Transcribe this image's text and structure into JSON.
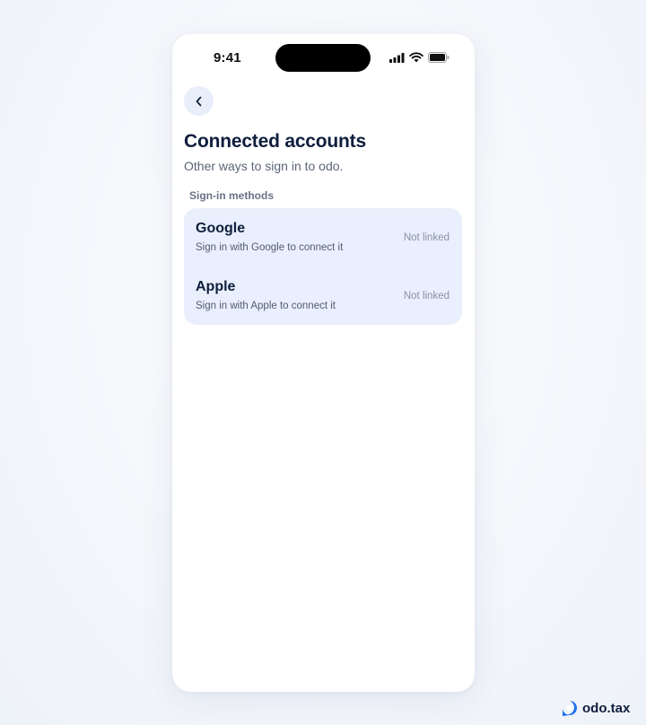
{
  "status_bar": {
    "time": "9:41",
    "icons": [
      "signal-icon",
      "wifi-icon",
      "battery-icon"
    ]
  },
  "header": {
    "back_icon": "chevron-left-icon",
    "title": "Connected accounts",
    "subtitle": "Other ways to sign in to odo."
  },
  "section": {
    "label": "Sign-in methods"
  },
  "methods": [
    {
      "name": "Google",
      "description": "Sign in with Google to connect it",
      "status": "Not linked"
    },
    {
      "name": "Apple",
      "description": "Sign in with Apple to connect it",
      "status": "Not linked"
    }
  ],
  "brand": {
    "name": "odo.tax",
    "logo_icon": "odo-logo-icon"
  },
  "colors": {
    "card_background": "#e9effc",
    "back_button_background": "#e9eefb",
    "title_text": "#0f1e3d",
    "brand_blue": "#1f6ff2"
  }
}
